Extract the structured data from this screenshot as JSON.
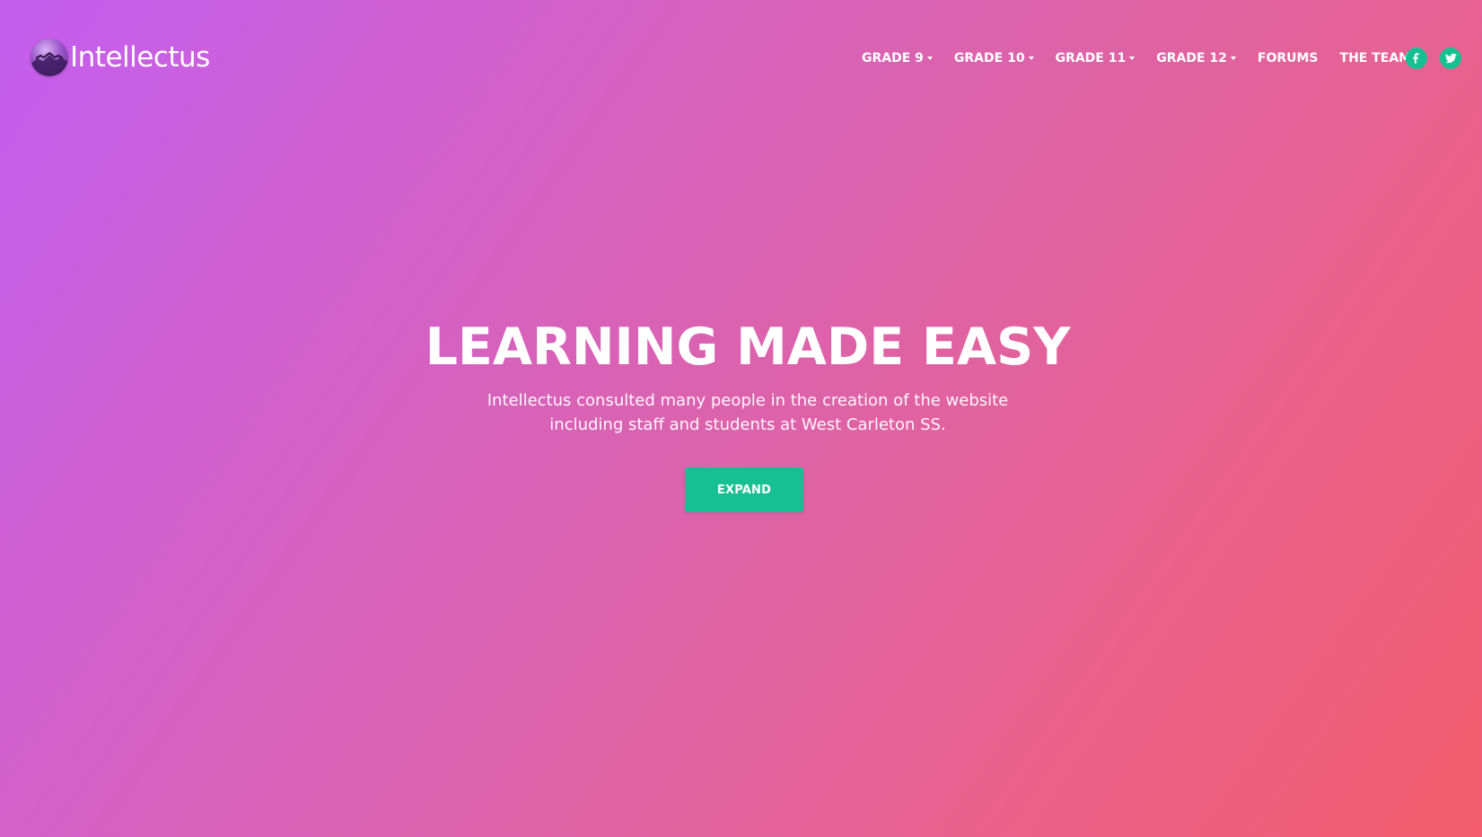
{
  "brand": {
    "name": "Intellectus",
    "logo_icon": "mountain-sunset-logo-icon"
  },
  "nav": {
    "items": [
      {
        "label": "GRADE 9",
        "has_dropdown": true
      },
      {
        "label": "GRADE 10",
        "has_dropdown": true
      },
      {
        "label": "GRADE 11",
        "has_dropdown": true
      },
      {
        "label": "GRADE 12",
        "has_dropdown": true
      },
      {
        "label": "FORUMS",
        "has_dropdown": false
      },
      {
        "label": "THE TEAM",
        "has_dropdown": false
      }
    ]
  },
  "social": {
    "facebook_icon": "facebook-icon",
    "twitter_icon": "twitter-icon",
    "accent_color": "#17c092"
  },
  "hero": {
    "title": "LEARNING MADE EASY",
    "subtitle_line1": "Intellectus consulted many people in the creation of the website",
    "subtitle_line2": "including staff and students at West Carleton SS.",
    "cta_label": "EXPAND"
  },
  "colors": {
    "gradient_start": "#c45ef0",
    "gradient_end": "#f55d6c",
    "button": "#17c092",
    "text": "#ffffff"
  }
}
